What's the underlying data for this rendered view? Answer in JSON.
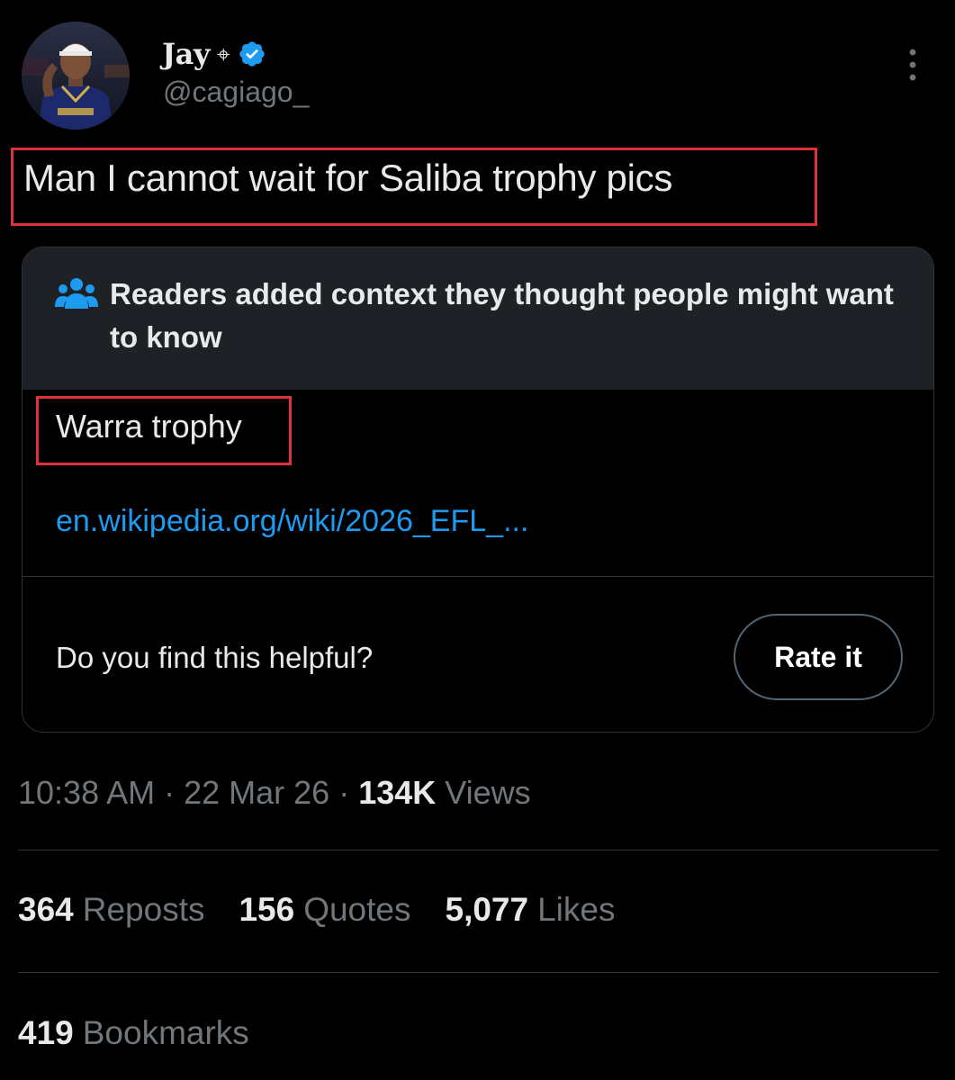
{
  "author": {
    "display_name": "Jay",
    "name_glyph": "⌖",
    "handle": "@cagiago_",
    "verified": true,
    "verified_color": "#1d9bf0"
  },
  "tweet": {
    "text": "Man I cannot wait for Saliba trophy pics"
  },
  "community_note": {
    "title": "Readers added context they thought people might want to know",
    "body": "Warra trophy",
    "link": "en.wikipedia.org/wiki/2026_EFL_...",
    "helpful_prompt": "Do you find this helpful?",
    "rate_label": "Rate it",
    "icon": "people-icon",
    "link_color": "#1d9bf0"
  },
  "meta": {
    "time": "10:38 AM",
    "separator": " · ",
    "date": "22 Mar 26",
    "views_count": "134K",
    "views_label": "Views"
  },
  "stats": {
    "reposts_count": "364",
    "reposts_label": "Reposts",
    "quotes_count": "156",
    "quotes_label": "Quotes",
    "likes_count": "5,077",
    "likes_label": "Likes",
    "bookmarks_count": "419",
    "bookmarks_label": "Bookmarks"
  },
  "highlight_color": "#e0323a"
}
